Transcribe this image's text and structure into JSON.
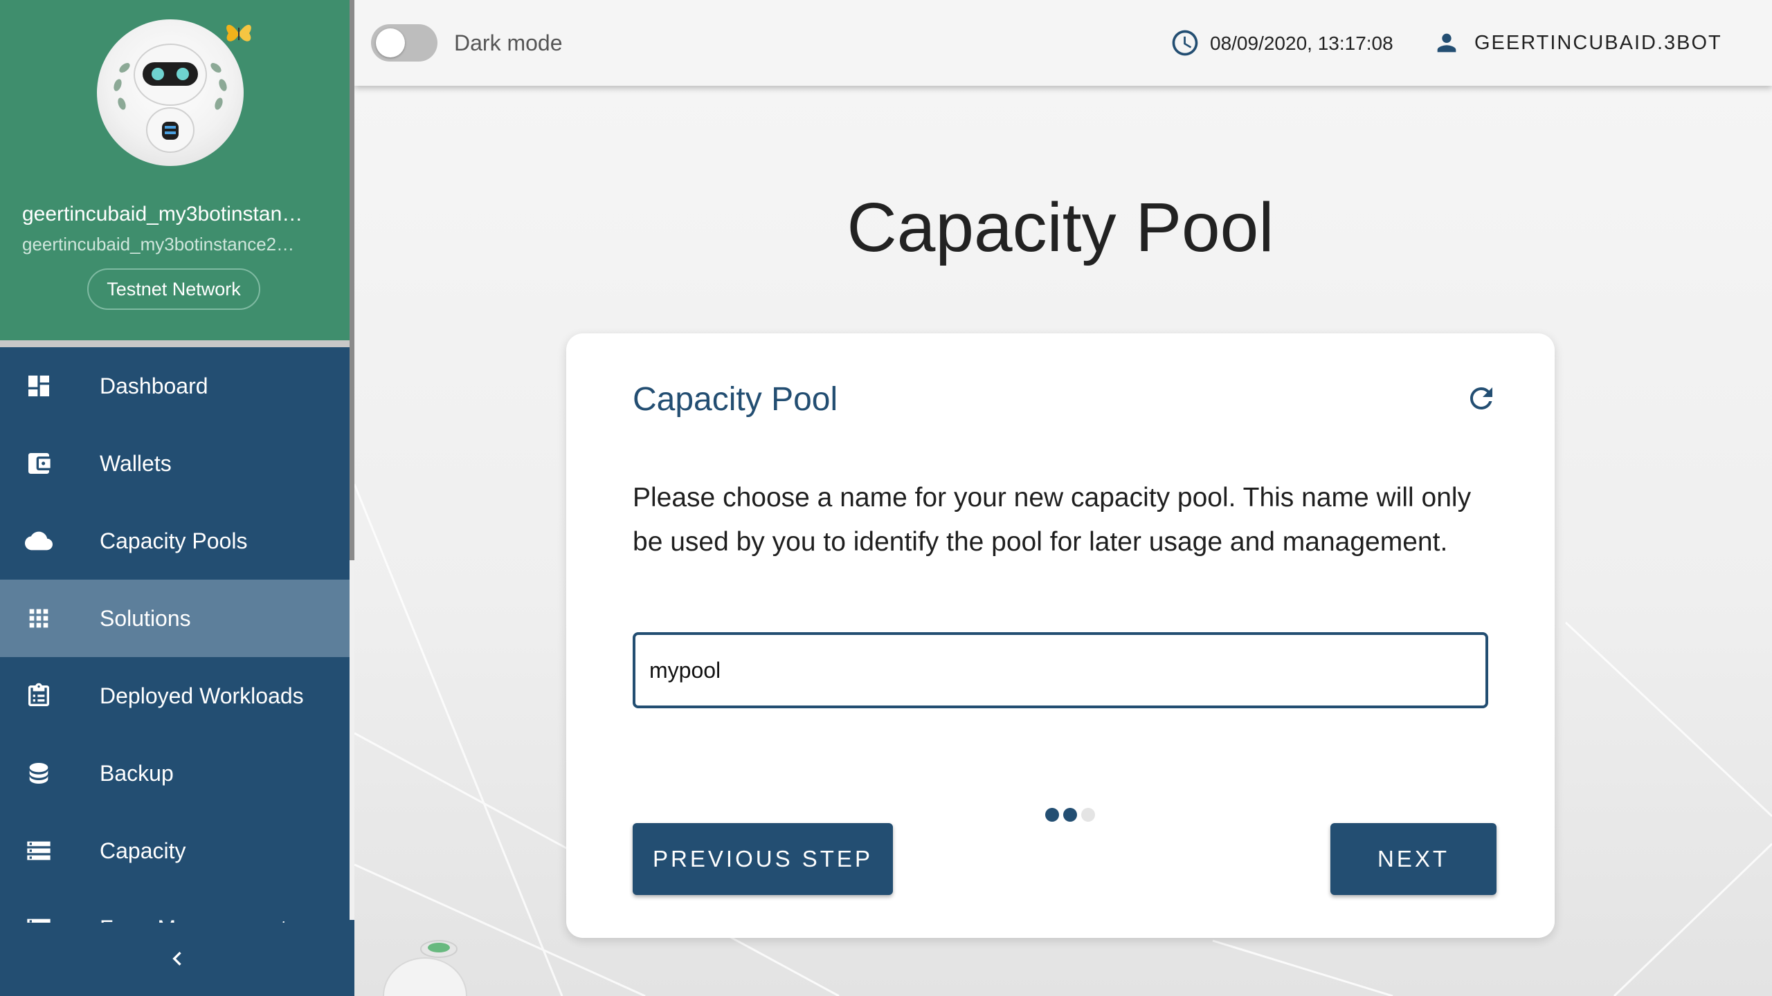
{
  "profile": {
    "name": "geertincubaid_my3botinstan…",
    "instance": "geertincubaid_my3botinstance2…",
    "network": "Testnet Network"
  },
  "nav": {
    "items": [
      {
        "label": "Dashboard",
        "icon": "dashboard-icon"
      },
      {
        "label": "Wallets",
        "icon": "wallet-icon"
      },
      {
        "label": "Capacity Pools",
        "icon": "cloud-icon"
      },
      {
        "label": "Solutions",
        "icon": "apps-grid-icon",
        "active": true
      },
      {
        "label": "Deployed Workloads",
        "icon": "clipboard-list-icon"
      },
      {
        "label": "Backup",
        "icon": "database-icon"
      },
      {
        "label": "Capacity",
        "icon": "storage-icon"
      },
      {
        "label": "Farm Management",
        "icon": "server-icon"
      }
    ]
  },
  "topbar": {
    "dark_mode_label": "Dark mode",
    "dark_mode_on": false,
    "datetime": "08/09/2020, 13:17:08",
    "username": "GEERTINCUBAID.3BOT"
  },
  "page": {
    "title": "Capacity Pool"
  },
  "card": {
    "title": "Capacity Pool",
    "description": "Please choose a name for your new capacity pool. This name will only be used by you to identify the pool for later usage and management.",
    "input_value": "mypool",
    "steps_total": 3,
    "current_step": 2,
    "prev_label": "PREVIOUS STEP",
    "next_label": "NEXT"
  },
  "colors": {
    "sidebar": "#234e72",
    "profile_bg": "#3f8e6d",
    "accent": "#234e72",
    "active_nav": "#5d7f9b"
  }
}
